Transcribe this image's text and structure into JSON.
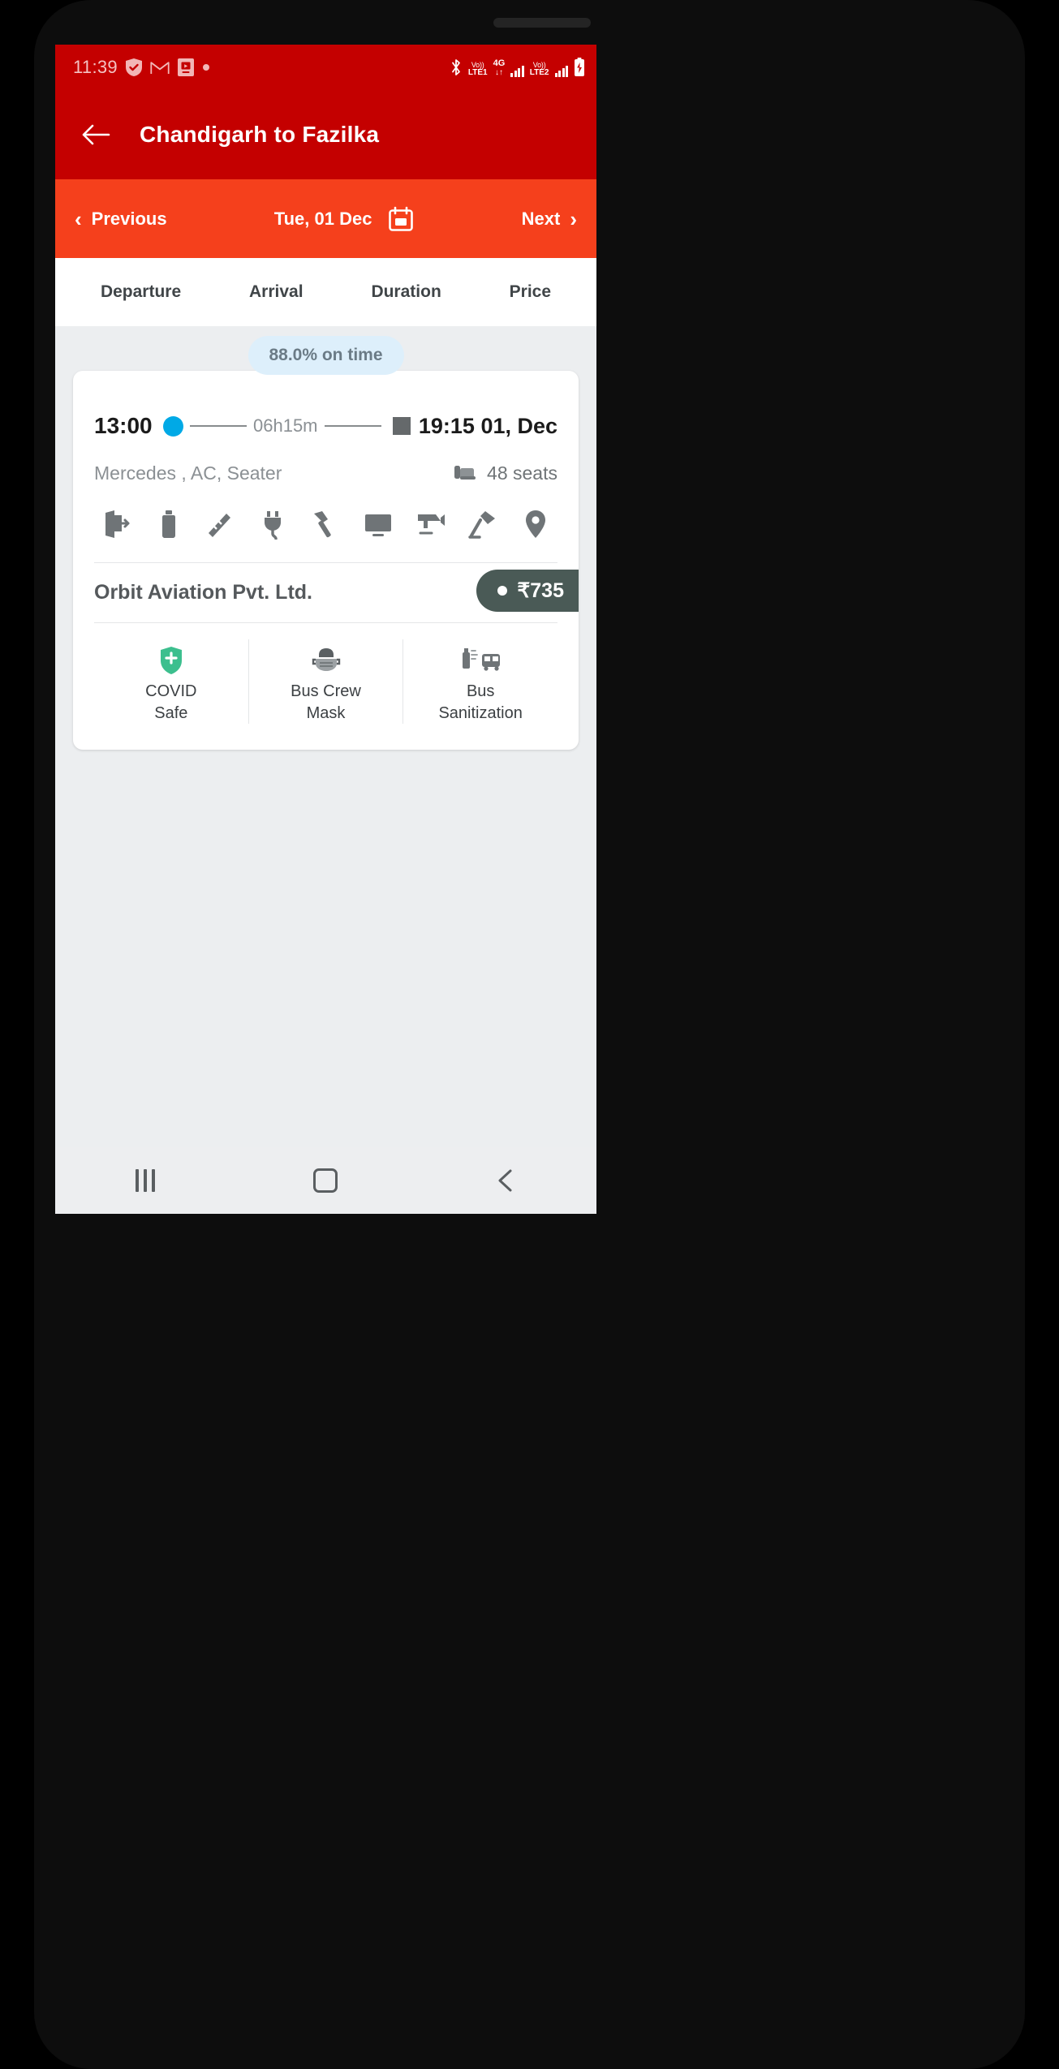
{
  "statusbar": {
    "time": "11:39",
    "left_icons": [
      "shield-check-icon",
      "gmail-icon",
      "screen-record-icon",
      "dot-icon"
    ],
    "bluetooth": "bluetooth-icon",
    "sim1_volte_top": "Vo))",
    "sim1_volte_bottom": "LTE1",
    "network": "4G",
    "network_arrows": "↓↑",
    "sim2_volte_top": "Vo))",
    "sim2_volte_bottom": "LTE2",
    "battery": "battery-charging-icon"
  },
  "appbar": {
    "back": "back-arrow-icon",
    "title": "Chandigarh to Fazilka"
  },
  "datebar": {
    "previous_label": "Previous",
    "previous_chevron": "‹",
    "date": "Tue, 01 Dec",
    "calendar_icon": "calendar-icon",
    "next_label": "Next",
    "next_chevron": "›"
  },
  "sort_tabs": [
    {
      "label": "Departure"
    },
    {
      "label": "Arrival"
    },
    {
      "label": "Duration"
    },
    {
      "label": "Price"
    }
  ],
  "bus": {
    "ontime_badge": "88.0% on time",
    "departure_time": "13:00",
    "duration": "06h15m",
    "arrival_time": "19:15 01, Dec",
    "bus_type": "Mercedes , AC, Seater",
    "seats_icon": "seat-icon",
    "seats": "48 seats",
    "amenities": [
      {
        "icon": "emergency-exit-icon"
      },
      {
        "icon": "water-bottle-icon"
      },
      {
        "icon": "blanket-icon"
      },
      {
        "icon": "charging-point-icon"
      },
      {
        "icon": "emergency-hammer-icon"
      },
      {
        "icon": "tv-icon"
      },
      {
        "icon": "cctv-camera-icon"
      },
      {
        "icon": "reading-light-icon"
      },
      {
        "icon": "gps-tracking-icon"
      }
    ],
    "operator": "Orbit Aviation Pvt. Ltd.",
    "price": "₹735",
    "safety": [
      {
        "icon": "covid-shield-icon",
        "label": "COVID\nSafe",
        "line1": "COVID",
        "line2": "Safe"
      },
      {
        "icon": "mask-face-icon",
        "label": "Bus Crew Mask",
        "line1": "Bus Crew",
        "line2": "Mask"
      },
      {
        "icon": "sanitize-spray-bus-icon",
        "label": "Bus Sanitization",
        "line1": "Bus",
        "line2": "Sanitization"
      }
    ]
  },
  "navbar": {
    "recents": "recents-icon",
    "home": "home-icon",
    "back": "back-icon"
  },
  "colors": {
    "appbar_red": "#c40000",
    "datebar_orange": "#f5401c",
    "badge_blue_bg": "#ddeffb",
    "badge_text": "#6b7b86",
    "dot_blue": "#00a9e6",
    "price_tag": "#4a5a56",
    "covid_green": "#3cbf8e",
    "page_bg": "#eceef0"
  }
}
